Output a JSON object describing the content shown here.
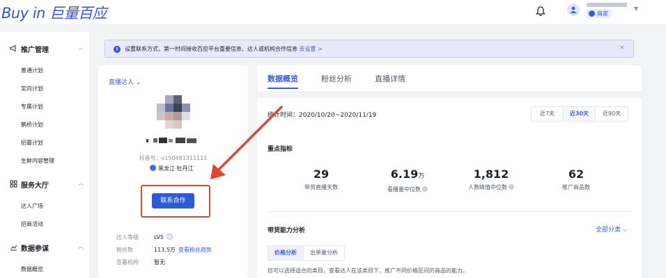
{
  "brand": {
    "logo_text": "Buy in 巨量百应"
  },
  "header": {
    "user_role": "商家"
  },
  "sidebar": {
    "sections": [
      {
        "label": "推广管理",
        "icon": "megaphone-icon",
        "items": [
          "普通计划",
          "定向计划",
          "专属计划",
          "鹊桥计划",
          "招募计划",
          "生鲜内容管理"
        ]
      },
      {
        "label": "服务大厅",
        "icon": "grid-icon",
        "items": [
          "达人广场",
          "招商活动"
        ]
      },
      {
        "label": "数据参谋",
        "icon": "chart-icon",
        "items": [
          "数据概览"
        ]
      }
    ]
  },
  "notice": {
    "text": "设置联系方式，第一时间接收百应平台重要信息、达人或机构合作信息",
    "link": "去设置 >",
    "close": "×"
  },
  "profile": {
    "type_label": "直播达人 ⌄",
    "douyin_id": "抖音号：v150481311111",
    "location": "黑龙江·牡丹江",
    "contact_button": "联系合作",
    "info": [
      {
        "label": "达人等级",
        "value": "LV5",
        "link": ""
      },
      {
        "label": "粉丝数",
        "value": "113.5万",
        "link": "查看粉丝趋势"
      },
      {
        "label": "签署机构",
        "value": "暂无",
        "link": ""
      }
    ]
  },
  "tabs": [
    {
      "label": "数据概览",
      "active": true
    },
    {
      "label": "粉丝分析",
      "active": false
    },
    {
      "label": "直播详情",
      "active": false
    }
  ],
  "overview": {
    "stat_period": "统计时间：2020/10/20~2020/11/19",
    "ranges": [
      {
        "label": "近7天",
        "selected": false
      },
      {
        "label": "近30天",
        "selected": true
      },
      {
        "label": "近90天",
        "selected": false
      }
    ],
    "key_metrics_title": "重点指标",
    "metrics": [
      {
        "value": "29",
        "unit": "",
        "label": "带货直播天数",
        "help": false
      },
      {
        "value": "6.19",
        "unit": "万",
        "label": "看播量中位数",
        "help": true
      },
      {
        "value": "1,812",
        "unit": "",
        "label": "人数峰值中位数",
        "help": true
      },
      {
        "value": "62",
        "unit": "",
        "label": "推广商品数",
        "help": false
      }
    ],
    "capability_title": "带货能力分析",
    "all_categories": "全部分类 ⌵",
    "sub_tabs": [
      {
        "label": "价格分析",
        "selected": true
      },
      {
        "label": "出单量分析",
        "selected": false
      }
    ],
    "hint": "您可以选择适合的类目，查看达人在该类目下，推广不同价格区间的商品的能力。"
  },
  "colors": {
    "accent": "#3b5bdb",
    "annotation_red": "#e5432b",
    "brand_blue": "#3b4fe0"
  }
}
